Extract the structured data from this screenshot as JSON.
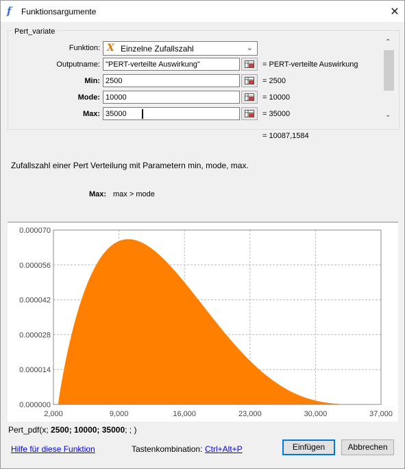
{
  "window": {
    "title": "Funktionsargumente",
    "close_glyph": "✕"
  },
  "group": {
    "title": "Pert_variate"
  },
  "fields": {
    "funktion": {
      "label": "Funktion:",
      "value": "Einzelne Zufallszahl"
    },
    "outputname": {
      "label": "Outputname:",
      "value": "\"PERT-verteilte Auswirkung\"",
      "result": "= PERT-verteilte Auswirkung"
    },
    "min": {
      "label": "Min:",
      "value": "2500",
      "result": "= 2500"
    },
    "mode": {
      "label": "Mode:",
      "value": "10000",
      "result": "= 10000"
    },
    "max": {
      "label": "Max:",
      "value": "35000",
      "result": "= 35000"
    }
  },
  "overall_result": "=   10087,1584",
  "description": "Zufallszahl einer Pert Verteilung mit Parametern min, mode, max.",
  "param_help": {
    "name": "Max:",
    "text": "max > mode"
  },
  "chart_data": {
    "type": "area",
    "distribution": "PERT",
    "params": {
      "min": 2500,
      "mode": 10000,
      "max": 35000
    },
    "xlim": [
      2000,
      37000
    ],
    "ylim": [
      0,
      7e-05
    ],
    "x_ticks": [
      "2,000",
      "9,000",
      "16,000",
      "23,000",
      "30,000",
      "37,000"
    ],
    "y_ticks": [
      "0.000000",
      "0.000014",
      "0.000028",
      "0.000042",
      "0.000056",
      "0.000070"
    ],
    "x_tick_values": [
      2000,
      9000,
      16000,
      23000,
      30000,
      37000
    ],
    "y_tick_values": [
      0,
      1.4e-05,
      2.8e-05,
      4.2e-05,
      5.6e-05,
      7e-05
    ],
    "fill_color": "#ff8000",
    "grid": true
  },
  "formula": {
    "prefix": "Pert_pdf(x; ",
    "args": "2500; 10000; 35000",
    "suffix": "; ; )"
  },
  "footer": {
    "help_link": "Hilfe für diese Funktion",
    "shortcut_label": "Tastenkombination:",
    "shortcut": "Ctrl+Alt+P",
    "insert_button": "Einfügen",
    "cancel_button": "Abbrechen"
  }
}
